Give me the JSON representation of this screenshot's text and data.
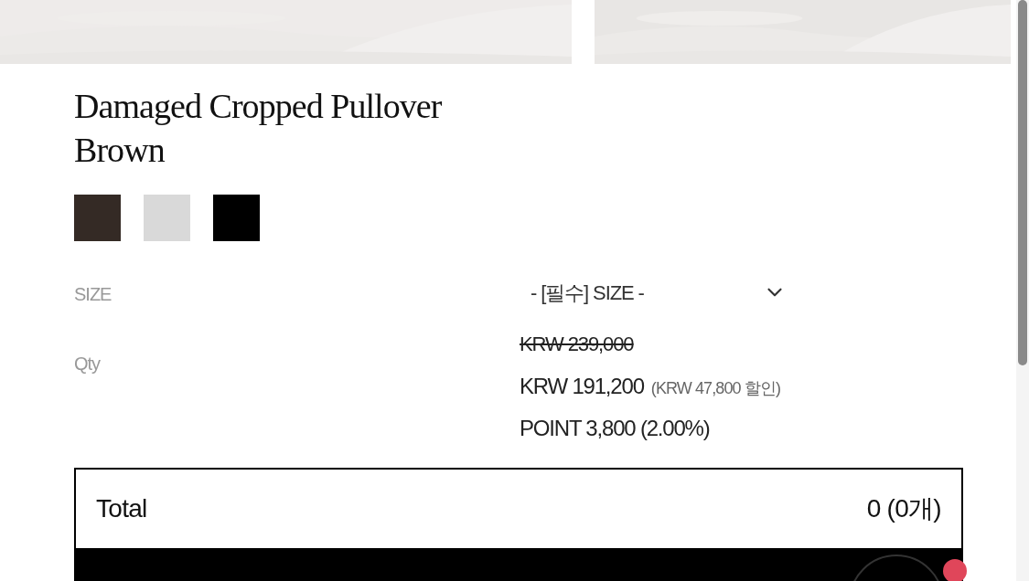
{
  "product": {
    "name": "Damaged Cropped Pullover",
    "color_name": "Brown"
  },
  "swatches": [
    {
      "color": "#342a25"
    },
    {
      "color": "#d9d9d9"
    },
    {
      "color": "#000000"
    }
  ],
  "options": {
    "size_label": "SIZE",
    "size_select": "- [필수] SIZE -",
    "qty_label": "Qty"
  },
  "prices": {
    "original": "KRW 239,000",
    "sale": "KRW 191,200",
    "discount": "(KRW 47,800 할인)",
    "point": "POINT 3,800 (2.00%)"
  },
  "total": {
    "label": "Total",
    "value": "0 (0개)"
  }
}
